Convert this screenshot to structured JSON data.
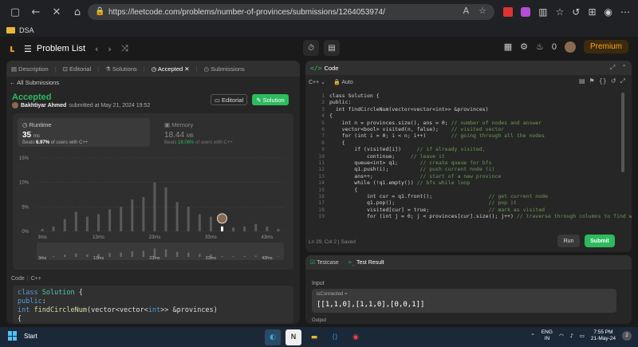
{
  "browser": {
    "url": "https://leetcode.com/problems/number-of-provinces/submissions/1264053974/",
    "bookmark": "DSA"
  },
  "lc_header": {
    "problem_list": "Problem List",
    "premium": "Premium",
    "fire_count": "0"
  },
  "left": {
    "tabs": [
      "Description",
      "Editorial",
      "Solutions",
      "Accepted",
      "Submissions"
    ],
    "all_submissions": "All Submissions",
    "status": "Accepted",
    "author": "Bakhtiyar Ahmed",
    "submitted_text": "submitted at May 21, 2024 19:52",
    "editorial_btn": "Editorial",
    "solution_btn": "Solution",
    "runtime": {
      "label": "Runtime",
      "value": "35",
      "unit": "ms",
      "beats_prefix": "Beats",
      "beats_pct": "6.97%",
      "beats_suffix": "of users with C++"
    },
    "memory": {
      "label": "Memory",
      "value": "18.44",
      "unit": "MB",
      "beats_prefix": "Beats",
      "beats_pct": "18.06%",
      "beats_suffix": "of users with C++"
    },
    "code_label": "Code",
    "code_lang": "C++",
    "code_lines": [
      "class Solution {",
      "public:",
      "  int findCircleNum(vector<vector<int>> &provinces)",
      "{"
    ]
  },
  "chart_data": {
    "type": "bar",
    "ylabel": "",
    "xlabel": "",
    "ytick_labels": [
      "15%",
      "10%",
      "5%",
      "0%"
    ],
    "ylim": [
      0,
      15
    ],
    "xtick_labels": [
      "3ms",
      "13ms",
      "23ms",
      "33ms",
      "43ms"
    ],
    "x": [
      3,
      5,
      7,
      9,
      11,
      13,
      15,
      17,
      19,
      21,
      23,
      25,
      27,
      29,
      31,
      33,
      35,
      37,
      39,
      41,
      43,
      45
    ],
    "values": [
      0.5,
      1.0,
      2.5,
      4.0,
      3.0,
      3.5,
      4.5,
      5.0,
      6.5,
      7.0,
      10.0,
      9.0,
      6.0,
      5.0,
      3.5,
      3.0,
      1.0,
      0.8,
      1.0,
      1.5,
      1.0,
      0.5
    ],
    "highlight_x": 35,
    "grid": true
  },
  "right_code": {
    "tab": "Code",
    "lang": "C++",
    "mode": "Auto",
    "status": "Ln 29, Col 2",
    "saved": "Saved",
    "run": "Run",
    "submit": "Submit",
    "lines": [
      {
        "n": "1",
        "code": "class Solution {",
        "cm": ""
      },
      {
        "n": "2",
        "code": "public:",
        "cm": ""
      },
      {
        "n": "3",
        "code": "  int findCircleNum(vector<vector<int>> &provinces)",
        "cm": ""
      },
      {
        "n": "4",
        "code": "{",
        "cm": ""
      },
      {
        "n": "5",
        "code": "    int n = provinces.size(), ans = 0;",
        "cm": " // number of nodes and answer"
      },
      {
        "n": "6",
        "code": "    vector<bool> visited(n, false);",
        "cm": "    // visited vector"
      },
      {
        "n": "7",
        "code": "    for (int i = 0; i < n; i++)",
        "cm": "        // going through all the nodes"
      },
      {
        "n": "8",
        "code": "    {",
        "cm": ""
      },
      {
        "n": "9",
        "code": "        if (visited[i])",
        "cm": "     // if already visited,"
      },
      {
        "n": "10",
        "code": "            continue;",
        "cm": "     // leave it"
      },
      {
        "n": "11",
        "code": "        queue<int> q1;",
        "cm": "       // create queue for bfs"
      },
      {
        "n": "12",
        "code": "        q1.push(i);",
        "cm": "          // push current node (i)"
      },
      {
        "n": "13",
        "code": "        ans++;",
        "cm": "               // start of a new province"
      },
      {
        "n": "14",
        "code": "        while (!q1.empty())",
        "cm": " // bfs while loop"
      },
      {
        "n": "15",
        "code": "        {",
        "cm": ""
      },
      {
        "n": "16",
        "code": "            int cur = q1.front();",
        "cm": "                  // get current node"
      },
      {
        "n": "17",
        "code": "            q1.pop();",
        "cm": "                              // pop it"
      },
      {
        "n": "18",
        "code": "            visited[cur] = true;",
        "cm": "                   // mark as visited"
      },
      {
        "n": "19",
        "code": "            for (int j = 0; j < provinces[cur].size(); j++)",
        "cm": " // traverse through columns to find wh"
      }
    ]
  },
  "test_panel": {
    "testcase_tab": "Testcase",
    "result_tab": "Test Result",
    "input_label": "Input",
    "var_name": "isConnected =",
    "var_value": "[[1,1,0],[1,1,0],[0,0,1]]",
    "output_label": "Output"
  },
  "taskbar": {
    "start": "Start",
    "lang_top": "ENG",
    "lang_bottom": "IN",
    "time": "7:55 PM",
    "date": "21-May-24",
    "notifications": "2"
  }
}
